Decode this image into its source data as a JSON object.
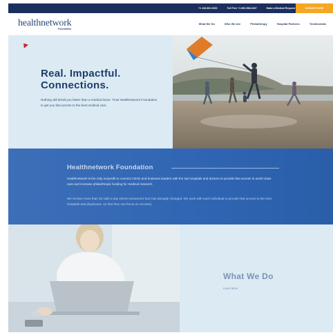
{
  "topbar": {
    "phone": "+1 440-892-0020",
    "tollfree": "Toll Free +1 866-968-2467",
    "request": "Make a Medical Request",
    "donate": "DONATE NOW"
  },
  "header": {
    "logo_text": "healthnetwork",
    "logo_sub": "Foundation",
    "nav": [
      "What We Do",
      "Who We Are",
      "Philanthropy",
      "Hospital Partners",
      "Testimonials"
    ]
  },
  "hero": {
    "title_line1": "Real. Impactful.",
    "title_line2": "Connections.",
    "text": "Nothing will derail you faster than a medical issue. Trust Healthnetwork Foundation to get you fast access to the best medical care."
  },
  "band": {
    "title": "Healthnetwork Foundation",
    "p1": "Healthnetwork is the only nonprofit to connect CEOs and business leaders with the top hospitals and doctors to provide fast access to world class care and increase philanthropic funding for medical research.",
    "p2": "We receive more than 20 calls a day where someone's luck has abruptly changed. We work with each individual to provide fast access to the best hospitals and physicians, so that they can focus on recovery."
  },
  "what_we_do": {
    "title": "What We Do",
    "link": "Learn More"
  },
  "colors": {
    "navy": "#1b2f5e",
    "donate": "#f5a623",
    "band": "#2f65b3",
    "light_panel": "#dceaf3"
  }
}
